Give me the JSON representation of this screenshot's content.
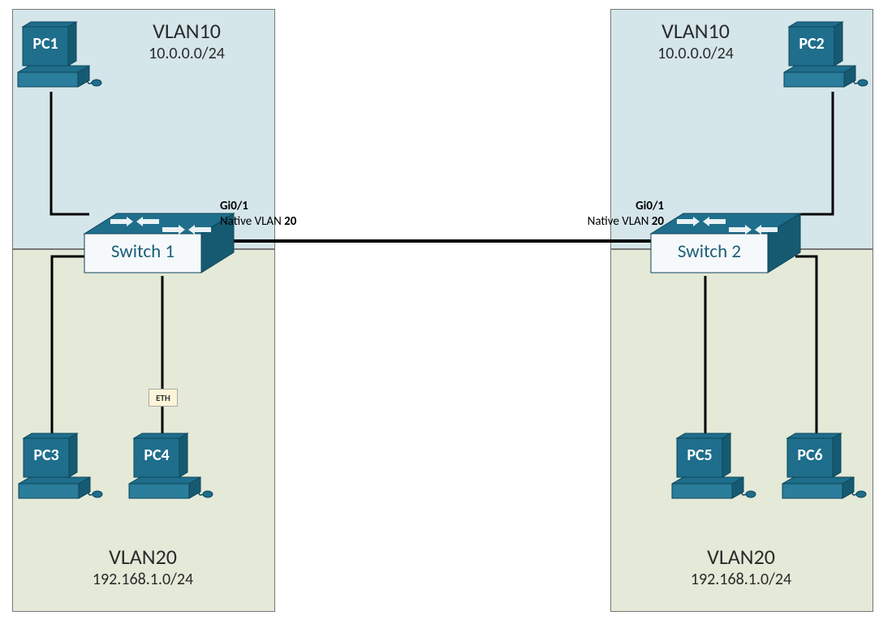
{
  "vlans": {
    "top_left": {
      "title": "VLAN10",
      "cidr": "10.0.0.0/24"
    },
    "top_right": {
      "title": "VLAN10",
      "cidr": "10.0.0.0/24"
    },
    "bottom_left": {
      "title": "VLAN20",
      "cidr": "192.168.1.0/24"
    },
    "bottom_right": {
      "title": "VLAN20",
      "cidr": "192.168.1.0/24"
    }
  },
  "switches": {
    "left": {
      "name": "Switch 1",
      "port": "Gi0/1",
      "native": "Native VLAN ",
      "native_bold": "20"
    },
    "right": {
      "name": "Switch 2",
      "port": "Gi0/1",
      "native": "Native VLAN ",
      "native_bold": "20"
    }
  },
  "pcs": {
    "pc1": "PC1",
    "pc2": "PC2",
    "pc3": "PC3",
    "pc4": "PC4",
    "pc5": "PC5",
    "pc6": "PC6"
  },
  "eth_badge": "ETH"
}
